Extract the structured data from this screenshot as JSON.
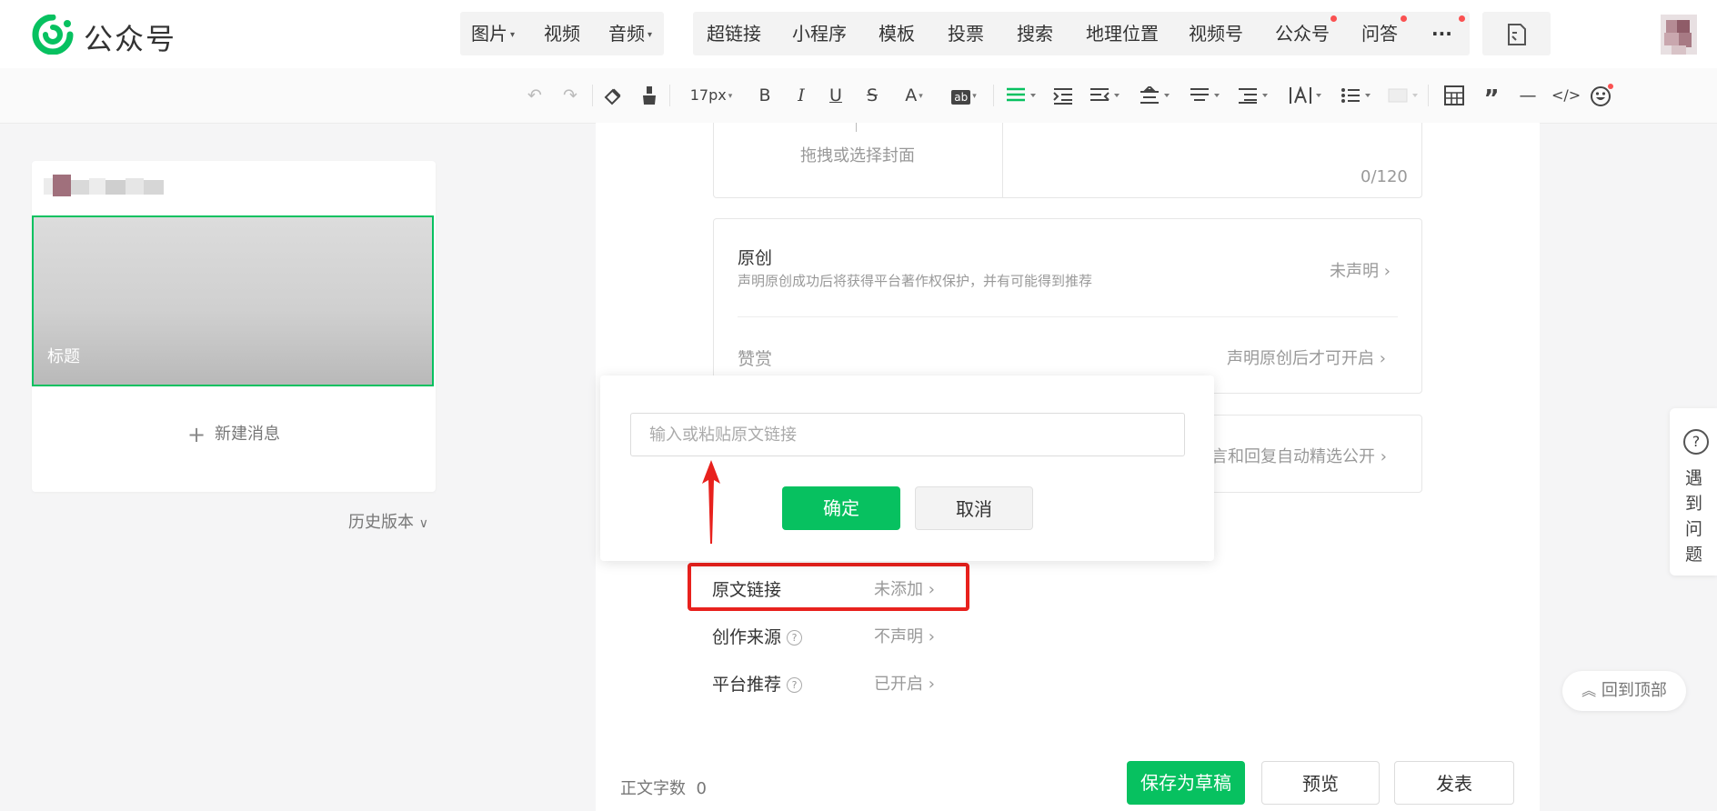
{
  "brand": {
    "name": "公众号"
  },
  "nav": {
    "group1": [
      {
        "label": "图片",
        "caret": true
      },
      {
        "label": "视频",
        "caret": false
      },
      {
        "label": "音频",
        "caret": true
      }
    ],
    "group2": [
      {
        "label": "超链接"
      },
      {
        "label": "小程序"
      },
      {
        "label": "模板"
      },
      {
        "label": "投票"
      },
      {
        "label": "搜索"
      },
      {
        "label": "地理位置"
      },
      {
        "label": "视频号"
      },
      {
        "label": "公众号",
        "dot": true
      },
      {
        "label": "问答",
        "dot": true
      },
      {
        "label": "···",
        "dot": true
      }
    ]
  },
  "toolbar": {
    "font_size": "17px"
  },
  "left": {
    "cover_title": "标题",
    "new_message": "新建消息",
    "history": "历史版本"
  },
  "cover": {
    "hint": "拖拽或选择封面",
    "counter": "0/120"
  },
  "original": {
    "title": "原创",
    "desc": "声明原创成功后将获得平台著作权保护，并有可能得到推荐",
    "value": "未声明 ›",
    "reward_label": "赞赏",
    "reward_value": "声明原创后才可开启 ›"
  },
  "comment": {
    "value": "言和回复自动精选公开 ›"
  },
  "settings": [
    {
      "label": "原文链接",
      "value": "未添加 ›",
      "help": false
    },
    {
      "label": "创作来源",
      "value": "不声明 ›",
      "help": true
    },
    {
      "label": "平台推荐",
      "value": "已开启 ›",
      "help": true
    }
  ],
  "popup": {
    "placeholder": "输入或粘贴原文链接",
    "confirm": "确定",
    "cancel": "取消"
  },
  "footer": {
    "word_count_label": "正文字数",
    "word_count": "0",
    "save_draft": "保存为草稿",
    "preview": "预览",
    "publish": "发表"
  },
  "side": {
    "help_icon": "?",
    "help_text": "遇到问题",
    "back_top": "回到顶部"
  },
  "colors": {
    "brand_green": "#07c160",
    "annotation_red": "#e8211d"
  }
}
